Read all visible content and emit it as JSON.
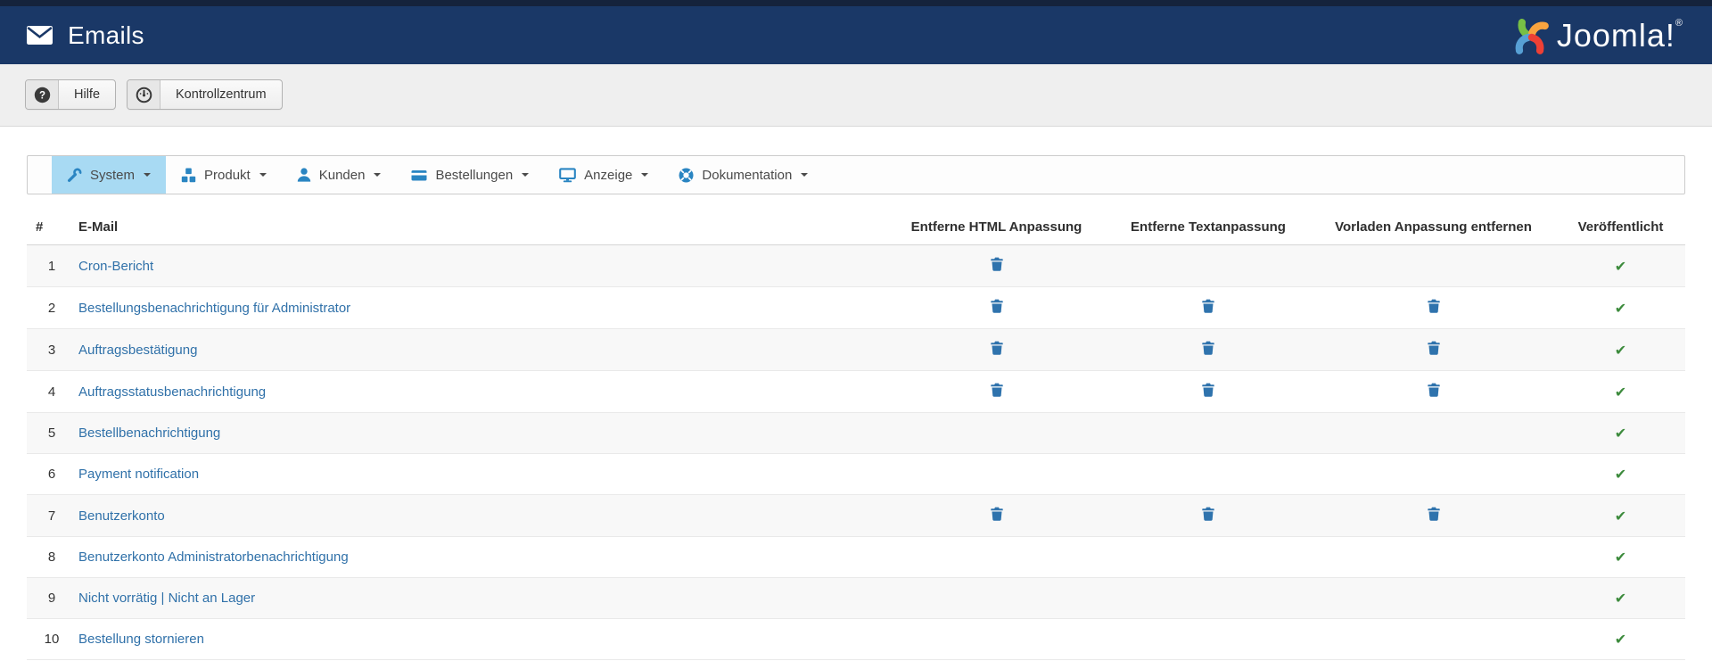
{
  "header": {
    "title": "Emails",
    "logo_text": "Joomla!",
    "logo_reg": "®"
  },
  "toolbar": {
    "buttons": [
      {
        "label": "Hilfe",
        "icon": "help-icon"
      },
      {
        "label": "Kontrollzentrum",
        "icon": "dashboard-icon"
      }
    ]
  },
  "menu": {
    "items": [
      {
        "label": "System",
        "icon": "wrench-icon",
        "active": true
      },
      {
        "label": "Produkt",
        "icon": "cubes-icon",
        "active": false
      },
      {
        "label": "Kunden",
        "icon": "user-icon",
        "active": false
      },
      {
        "label": "Bestellungen",
        "icon": "credit-card-icon",
        "active": false
      },
      {
        "label": "Anzeige",
        "icon": "display-icon",
        "active": false
      },
      {
        "label": "Dokumentation",
        "icon": "life-ring-icon",
        "active": false
      }
    ]
  },
  "table": {
    "columns": [
      "#",
      "E-Mail",
      "Entferne HTML Anpassung",
      "Entferne Textanpassung",
      "Vorladen Anpassung entfernen",
      "Veröffentlicht"
    ],
    "rows": [
      {
        "num": "1",
        "name": "Cron-Bericht",
        "remove_html": true,
        "remove_text": false,
        "remove_preload": false,
        "published": true
      },
      {
        "num": "2",
        "name": "Bestellungsbenachrichtigung für Administrator",
        "remove_html": true,
        "remove_text": true,
        "remove_preload": true,
        "published": true
      },
      {
        "num": "3",
        "name": "Auftragsbestätigung",
        "remove_html": true,
        "remove_text": true,
        "remove_preload": true,
        "published": true
      },
      {
        "num": "4",
        "name": "Auftragsstatusbenachrichtigung",
        "remove_html": true,
        "remove_text": true,
        "remove_preload": true,
        "published": true
      },
      {
        "num": "5",
        "name": "Bestellbenachrichtigung",
        "remove_html": false,
        "remove_text": false,
        "remove_preload": false,
        "published": true
      },
      {
        "num": "6",
        "name": "Payment notification",
        "remove_html": false,
        "remove_text": false,
        "remove_preload": false,
        "published": true
      },
      {
        "num": "7",
        "name": "Benutzerkonto",
        "remove_html": true,
        "remove_text": true,
        "remove_preload": true,
        "published": true
      },
      {
        "num": "8",
        "name": "Benutzerkonto Administratorbenachrichtigung",
        "remove_html": false,
        "remove_text": false,
        "remove_preload": false,
        "published": true
      },
      {
        "num": "9",
        "name": "Nicht vorrätig | Nicht an Lager",
        "remove_html": false,
        "remove_text": false,
        "remove_preload": false,
        "published": true
      },
      {
        "num": "10",
        "name": "Bestellung stornieren",
        "remove_html": false,
        "remove_text": false,
        "remove_preload": false,
        "published": true
      }
    ]
  },
  "icons": {
    "title_icon": "envelope-icon",
    "published_icon": "check-icon",
    "action_icon": "trash-icon",
    "help_glyph": "?",
    "check_glyph": "✔"
  },
  "colors": {
    "navbar_bg": "#1a3867",
    "top_strip": "#15233c",
    "toolbar_bg": "#efefef",
    "menu_active_bg": "#a8daf3",
    "menu_icon_blue": "#2a85c2",
    "link_blue": "#3071a9",
    "trash_blue": "#2f73ad",
    "check_green": "#3d8b3d",
    "stripe_bg": "#f8f8f8"
  }
}
